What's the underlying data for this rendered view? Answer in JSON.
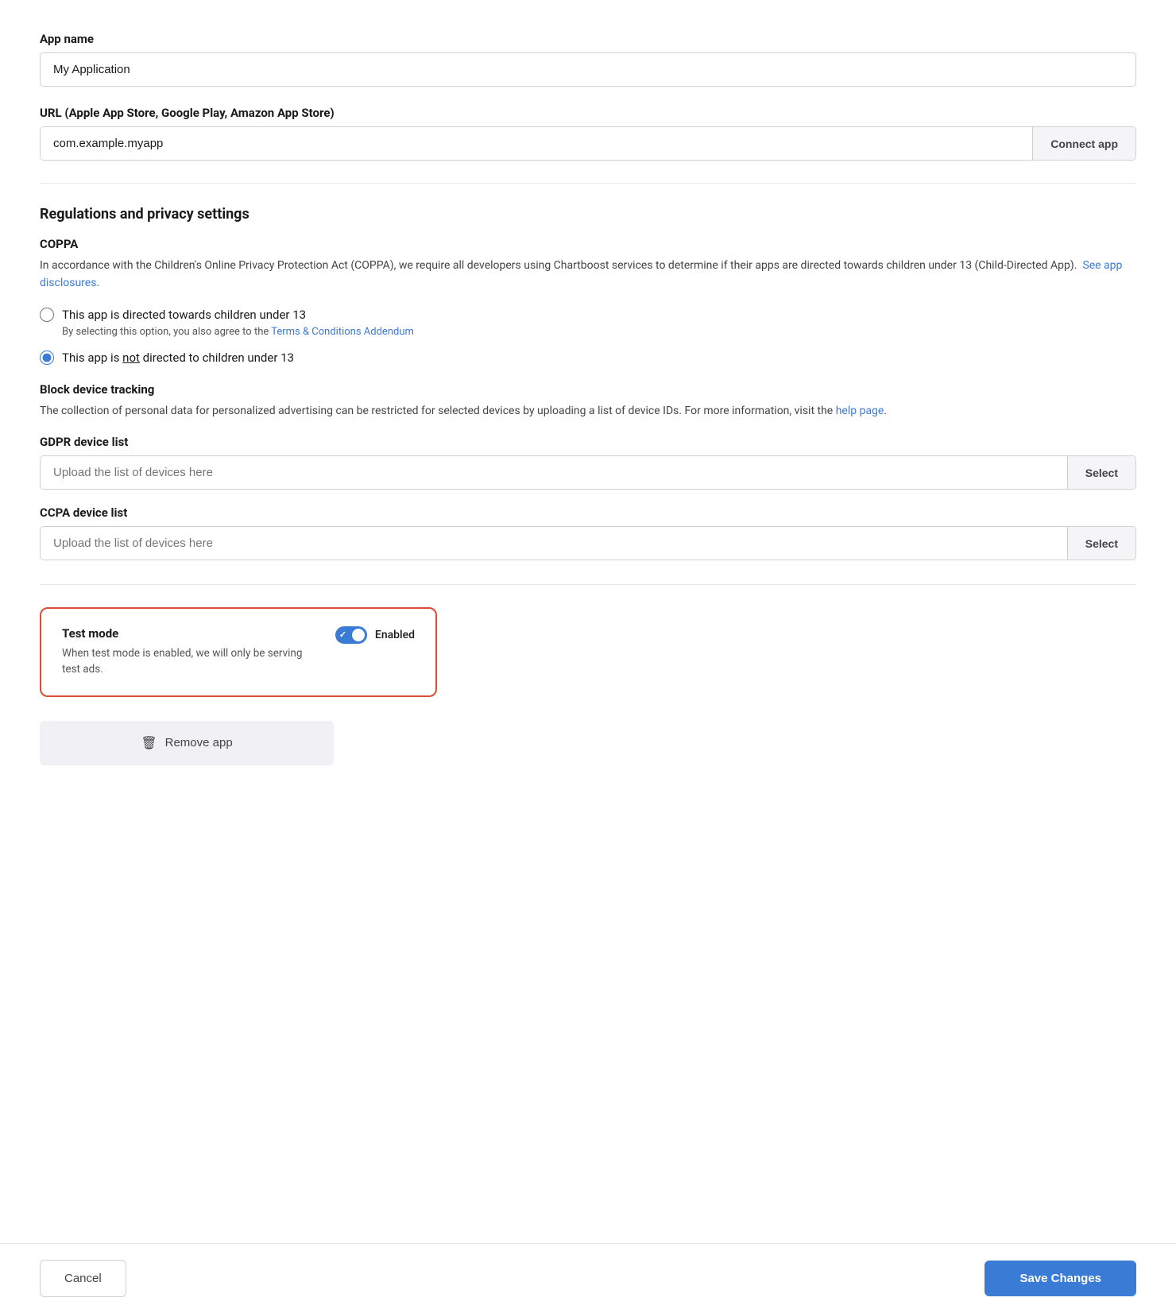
{
  "appName": {
    "label": "App name",
    "value": "My Application",
    "placeholder": "My Application"
  },
  "url": {
    "label": "URL (Apple App Store, Google Play, Amazon App Store)",
    "value": "com.example.myapp",
    "placeholder": "com.example.myapp",
    "buttonLabel": "Connect app"
  },
  "regulations": {
    "sectionTitle": "Regulations and privacy settings",
    "coppa": {
      "title": "COPPA",
      "description1": "In accordance with the Children's Online Privacy Protection Act (COPPA), we require all developers using Chartboost services to determine if their apps are directed towards children under 13 (Child-Directed App).",
      "seeAppDisclosuresLink": "See app disclosures",
      "radio1Label": "This app is directed towards children under 13",
      "radio1SubLabel1": "By selecting this option, you also agree to the ",
      "radio1SubLabelLink": "Terms & Conditions Addendum",
      "radio2LabelPre": "This app is ",
      "radio2LabelUnderline": "not",
      "radio2LabelPost": " directed to children under 13"
    },
    "blockDeviceTracking": {
      "title": "Block device tracking",
      "description": "The collection of personal data for personalized advertising can be restricted for selected devices by uploading a list of device IDs. For more information, visit the ",
      "helpPageLink": "help page"
    },
    "gdpr": {
      "label": "GDPR device list",
      "placeholder": "Upload the list of devices here",
      "buttonLabel": "Select"
    },
    "ccpa": {
      "label": "CCPA device list",
      "placeholder": "Upload the list of devices here",
      "buttonLabel": "Select"
    }
  },
  "testMode": {
    "title": "Test mode",
    "description": "When test mode is enabled, we will only be serving test ads.",
    "toggleLabel": "Enabled",
    "enabled": true
  },
  "removeApp": {
    "label": "Remove app"
  },
  "footer": {
    "cancelLabel": "Cancel",
    "saveLabel": "Save Changes"
  }
}
